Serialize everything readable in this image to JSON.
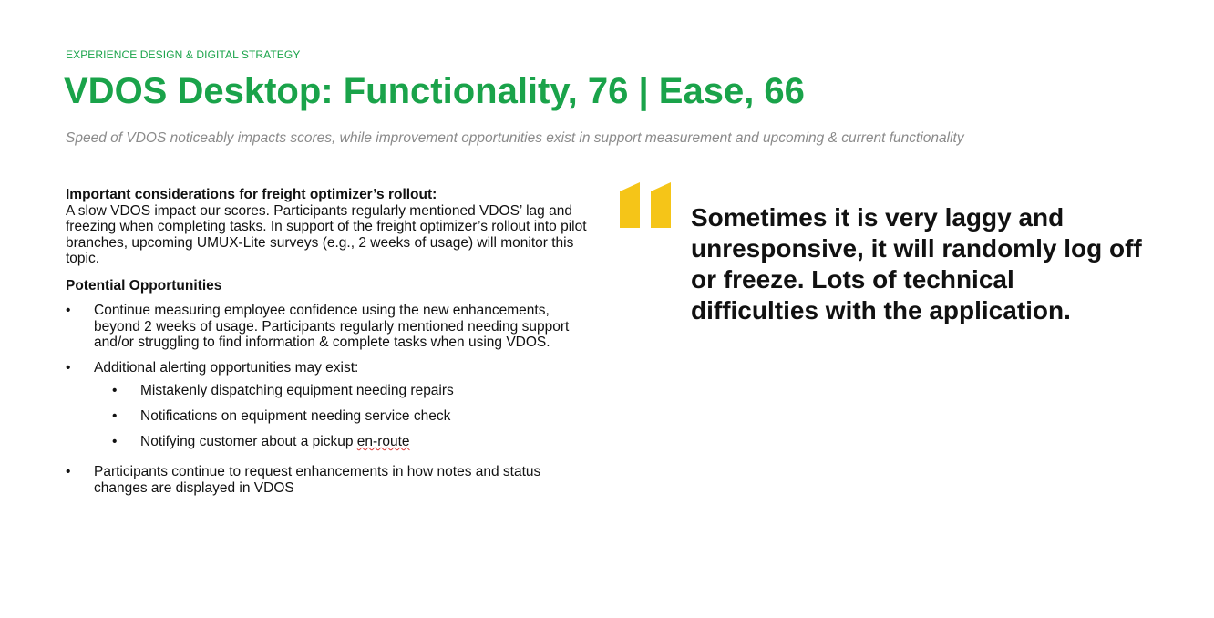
{
  "header": {
    "eyebrow": "EXPERIENCE DESIGN & DIGITAL STRATEGY",
    "title": "VDOS Desktop: Functionality, 76 | Ease, 66",
    "subtitle": "Speed of VDOS noticeably impacts scores, while improvement opportunities exist in support measurement and upcoming & current functionality"
  },
  "considerations": {
    "heading": "Important considerations for freight optimizer’s rollout:",
    "body": "A slow VDOS impact our scores. Participants regularly mentioned VDOS’ lag and freezing when completing tasks. In support of the freight optimizer’s rollout into pilot branches, upcoming UMUX-Lite surveys (e.g., 2 weeks of usage) will monitor this topic."
  },
  "opportunities": {
    "heading": "Potential Opportunities",
    "items": [
      "Continue measuring employee confidence using the new enhancements, beyond 2 weeks of usage. Participants regularly mentioned needing support and/or struggling to find information & complete tasks when using VDOS.",
      "Additional alerting opportunities may exist:",
      "Participants continue to request enhancements in how notes and status changes are displayed in VDOS"
    ],
    "sub_items": [
      "Mistakenly dispatching equipment needing repairs",
      "Notifications on equipment needing service check",
      "Notifying customer about a pickup ",
      "en-route"
    ]
  },
  "quote": {
    "text": "Sometimes it is very laggy and unresponsive, it will randomly log off or freeze. Lots of technical difficulties with the application.",
    "icon": "quote-mark-icon",
    "accent_color": "#f5c518"
  },
  "colors": {
    "brand_green": "#1aa34a",
    "subtitle_gray": "#8a8a8a"
  }
}
